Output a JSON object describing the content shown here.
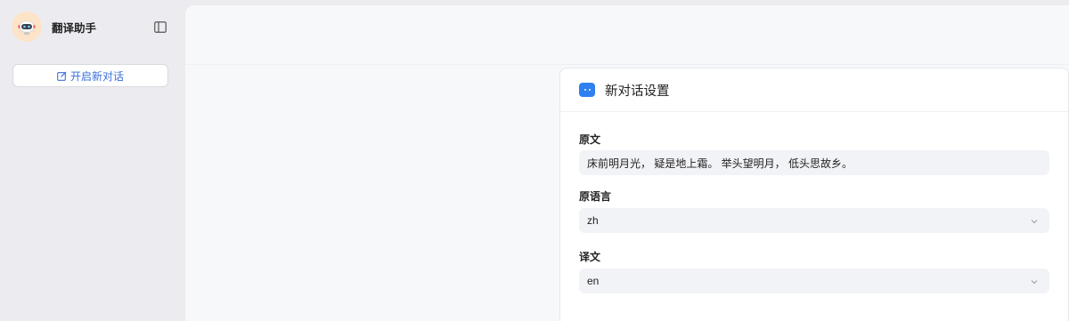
{
  "sidebar": {
    "app_name": "翻译助手",
    "new_chat_label": "开启新对话",
    "avatar_icon": "robot-avatar-icon",
    "collapse_icon": "sidebar-toggle-icon"
  },
  "panel": {
    "title": "新对话设置",
    "fields": {
      "source_text": {
        "label": "原文",
        "value": "床前明月光， 疑是地上霜。 举头望明月， 低头思故乡。"
      },
      "source_language": {
        "label": "原语言",
        "value": "zh"
      },
      "target_language": {
        "label": "译文",
        "value": "en"
      }
    }
  },
  "colors": {
    "accent": "#2f80f0",
    "link": "#3b6fd8"
  }
}
